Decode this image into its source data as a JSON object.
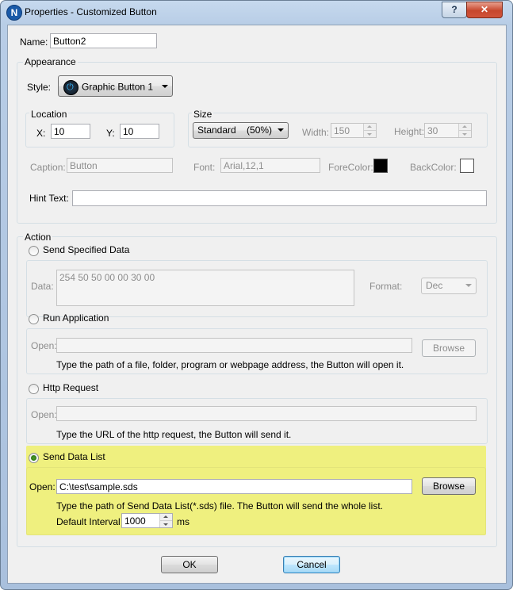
{
  "window": {
    "title": "Properties - Customized Button",
    "help_label": "?",
    "close_label": "✕",
    "app_icon_letter": "N"
  },
  "name": {
    "label": "Name:",
    "value": "Button2"
  },
  "appearance": {
    "title": "Appearance",
    "style_label": "Style:",
    "style_value": "Graphic Button 1",
    "location": {
      "title": "Location",
      "x_label": "X:",
      "x_value": "10",
      "y_label": "Y:",
      "y_value": "10"
    },
    "size": {
      "title": "Size",
      "mode_value": "Standard    (50%)",
      "width_label": "Width:",
      "width_value": "150",
      "height_label": "Height:",
      "height_value": "30"
    },
    "caption_label": "Caption:",
    "caption_value": "Button",
    "font_label": "Font:",
    "font_value": "Arial,12,1",
    "forecolor_label": "ForeColor:",
    "forecolor": "#000000",
    "backcolor_label": "BackColor:",
    "backcolor": "#ffffff",
    "hint_label": "Hint Text:",
    "hint_value": ""
  },
  "action": {
    "title": "Action",
    "send_specified": {
      "label": "Send Specified Data",
      "data_label": "Data:",
      "data_value": "254 50 50 00 00 30 00",
      "format_label": "Format:",
      "format_value": "Dec"
    },
    "run_application": {
      "label": "Run Application",
      "open_label": "Open:",
      "open_value": "",
      "browse_label": "Browse",
      "hint": "Type the path of a file, folder, program or webpage address, the Button will open it."
    },
    "http_request": {
      "label": "Http Request",
      "open_label": "Open:",
      "open_value": "",
      "hint": "Type the URL of the http request, the Button will send it."
    },
    "send_data_list": {
      "label": "Send Data List",
      "open_label": "Open:",
      "open_value": "C:\\test\\sample.sds",
      "browse_label": "Browse",
      "hint": "Type the path of Send Data List(*.sds) file. The Button will send the whole list.",
      "interval_label": "Default Interval",
      "interval_value": "1000",
      "interval_unit": "ms"
    },
    "selected": "send_data_list"
  },
  "footer": {
    "ok_label": "OK",
    "cancel_label": "Cancel"
  },
  "colors": {
    "highlight": "#eff07f",
    "radio_selected": "#2f8a18"
  }
}
